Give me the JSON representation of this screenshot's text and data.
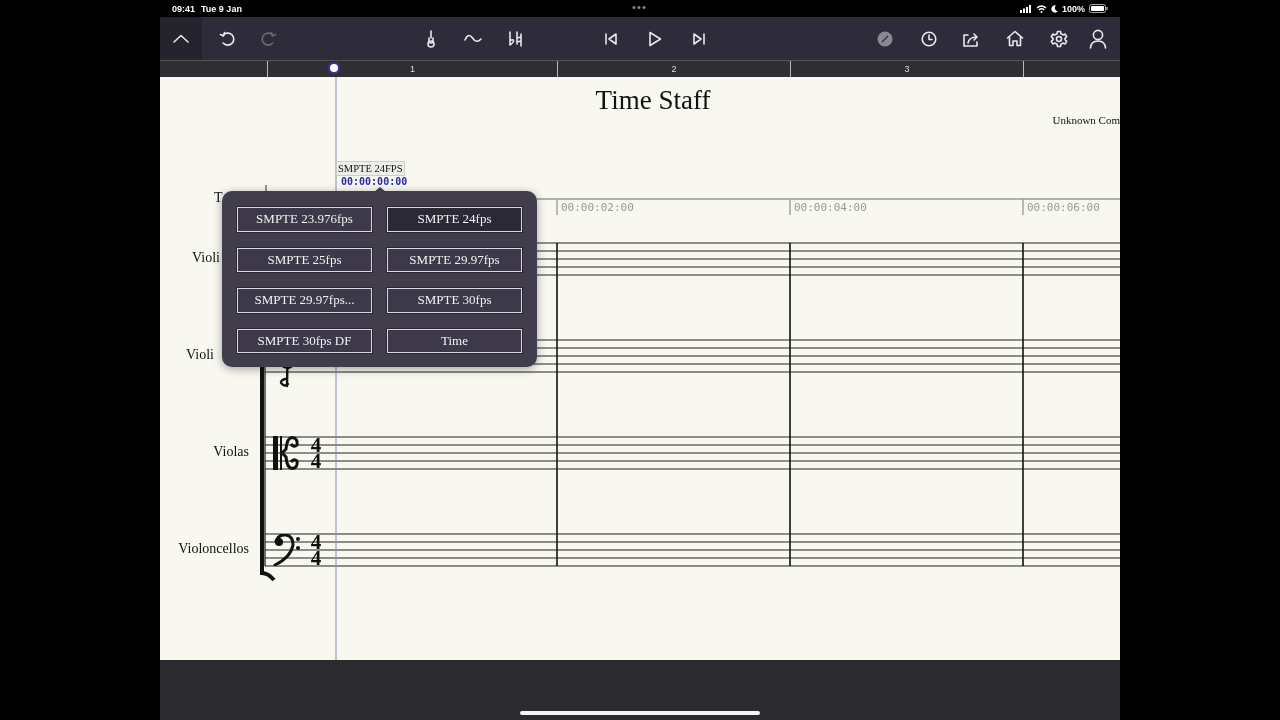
{
  "status_bar": {
    "time": "09:41",
    "date": "Tue 9 Jan",
    "battery": "100%"
  },
  "toolbar": {
    "undo": {
      "disabled": false
    },
    "redo": {
      "disabled": true
    }
  },
  "ruler": {
    "bars": [
      "1",
      "2",
      "3"
    ]
  },
  "score": {
    "title": "Time Staff",
    "composer": "Unknown Com",
    "time_staff": {
      "label": "T",
      "format": "SMPTE 24FPS",
      "start": "00:00:00:00",
      "marks": [
        "00:00:02:00",
        "00:00:04:00",
        "00:00:06:00"
      ]
    },
    "staves": [
      {
        "label": "Violi"
      },
      {
        "label": "Violi",
        "kind": "treble"
      },
      {
        "label": "Violas",
        "kind": "alto",
        "time_signature": [
          "4",
          "4"
        ]
      },
      {
        "label": "Violoncellos",
        "kind": "bass",
        "time_signature": [
          "4",
          "4"
        ]
      }
    ]
  },
  "popover": {
    "options": [
      {
        "label": "SMPTE 23.976fps",
        "selected": false
      },
      {
        "label": "SMPTE 24fps",
        "selected": true
      },
      {
        "label": "SMPTE 25fps",
        "selected": false
      },
      {
        "label": "SMPTE 29.97fps",
        "selected": false
      },
      {
        "label": "SMPTE 29.97fps...",
        "selected": false
      },
      {
        "label": "SMPTE 30fps",
        "selected": false
      },
      {
        "label": "SMPTE 30fps DF",
        "selected": false
      },
      {
        "label": "Time",
        "selected": false
      }
    ]
  }
}
